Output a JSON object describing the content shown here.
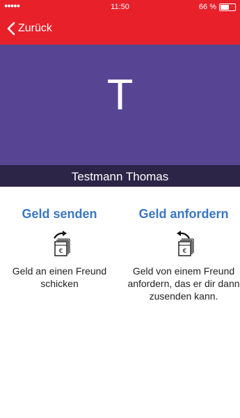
{
  "status": {
    "signal": "●●●●●",
    "time": "11:50",
    "battery_label": "66 %",
    "battery_level": 0.66
  },
  "nav": {
    "back_label": "Zurück"
  },
  "contact": {
    "initial": "T",
    "name": "Testmann Thomas"
  },
  "actions": {
    "send": {
      "title": "Geld senden",
      "description": "Geld an einen Freund schicken",
      "icon": "send-money-icon"
    },
    "request": {
      "title": "Geld anfordern",
      "description": "Geld von einem Freund anfordern, das er dir dann zusenden kann.",
      "icon": "request-money-icon"
    }
  },
  "colors": {
    "primary": "#e8202a",
    "header": "#574593",
    "namebar": "#2c2547",
    "link": "#3a76c3"
  }
}
